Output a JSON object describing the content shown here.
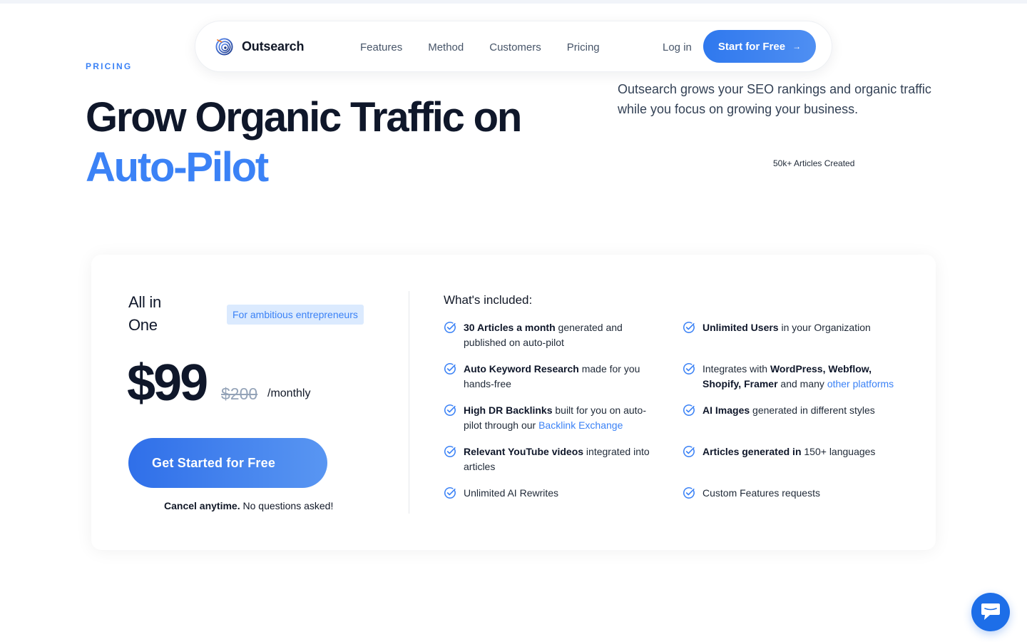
{
  "nav": {
    "brand": "Outsearch",
    "links": [
      "Features",
      "Method",
      "Customers",
      "Pricing"
    ],
    "login": "Log in",
    "cta": "Start for Free",
    "cta_arrow": "→"
  },
  "hero": {
    "eyebrow": "PRICING",
    "title_line1": "Grow Organic Traffic on",
    "title_line2": "Auto-Pilot",
    "description": "Outsearch grows your SEO rankings and organic traffic while you focus on growing your business.",
    "stat": "50k+ Articles Created"
  },
  "plan": {
    "name_line1": "All in",
    "name_line2": "One",
    "badge": "For ambitious entrepreneurs",
    "price": "$99",
    "old_price": "$200",
    "period": "/monthly",
    "cta": "Get Started for Free",
    "cancel_bold": "Cancel anytime.",
    "cancel_rest": " No questions asked!"
  },
  "included": {
    "title": "What's included:",
    "items": [
      {
        "bold": "30 Articles a month",
        "rest": " generated and published on auto-pilot",
        "pre": "",
        "link": ""
      },
      {
        "bold": "Auto Keyword Research",
        "rest": " made for you hands-free",
        "pre": "",
        "link": ""
      },
      {
        "bold": "High DR Backlinks",
        "rest": " built for you on auto-pilot through our ",
        "pre": "",
        "link": "Backlink Exchange"
      },
      {
        "bold": "Relevant YouTube videos",
        "rest": " integrated into articles",
        "pre": "",
        "link": ""
      },
      {
        "bold": "",
        "rest": "Unlimited AI Rewrites",
        "pre": "",
        "link": ""
      },
      {
        "bold": "Unlimited Users",
        "rest": " in your Organization",
        "pre": "",
        "link": ""
      },
      {
        "bold": "WordPress, Webflow, Shopify, Framer",
        "rest": " and many ",
        "pre": "Integrates with ",
        "link": "other platforms"
      },
      {
        "bold": "AI Images",
        "rest": " generated in different styles",
        "pre": "",
        "link": ""
      },
      {
        "bold": "Articles generated in",
        "rest": " 150+ languages",
        "pre": "",
        "link": ""
      },
      {
        "bold": "",
        "rest": "Custom Features requests",
        "pre": "",
        "link": ""
      }
    ]
  },
  "colors": {
    "accent": "#3b82f6",
    "heading": "#0f172a",
    "badge_bg": "#dbeafe",
    "chat": "#1d6ee8"
  },
  "icons": {
    "logo": "concentric-target-icon",
    "check": "check-circle-icon",
    "chat": "chat-bubble-icon"
  }
}
